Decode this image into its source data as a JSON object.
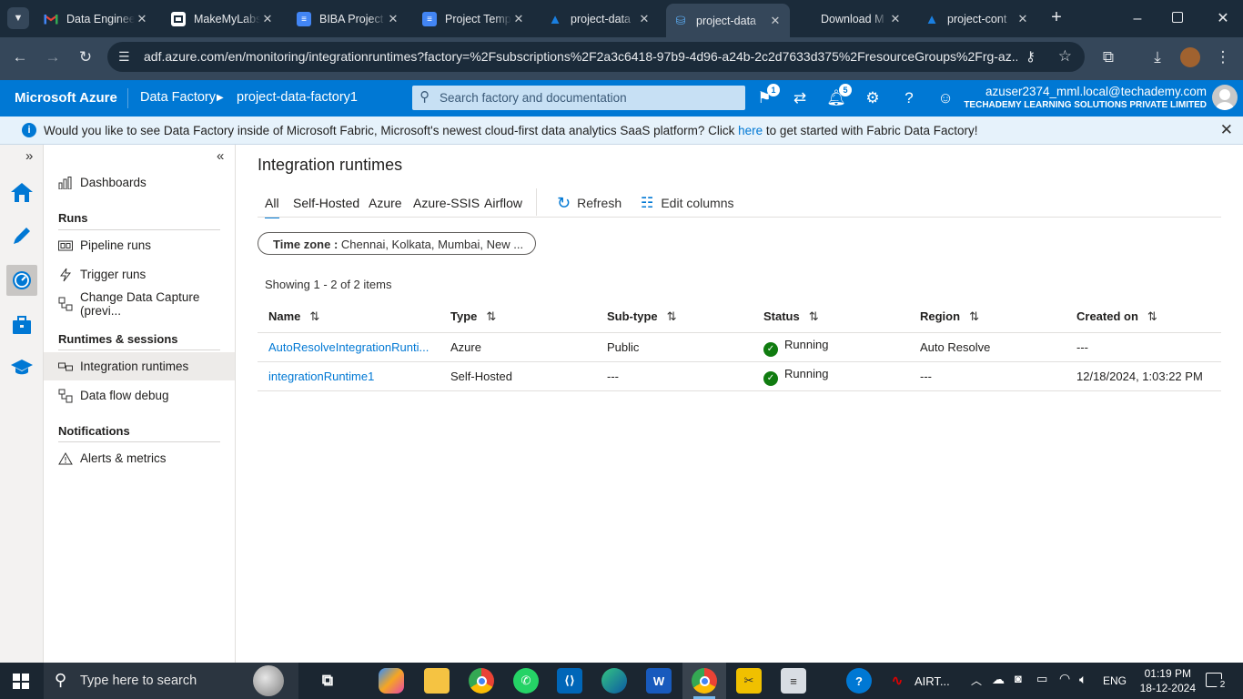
{
  "browser": {
    "tabs": [
      {
        "title": "Data Engineer",
        "favicon": "gmail-icon",
        "color": "#ea4335"
      },
      {
        "title": "MakeMyLabs",
        "favicon": "page-icon",
        "color": "#ffffff"
      },
      {
        "title": "BIBA Project",
        "favicon": "docs-icon",
        "color": "#4285f4"
      },
      {
        "title": "Project Temp",
        "favicon": "docs-icon",
        "color": "#4285f4"
      },
      {
        "title": "project-data",
        "favicon": "azure-icon",
        "color": "#1a7fe0"
      },
      {
        "title": "project-data",
        "favicon": "adf-icon",
        "color": "#59a5e8",
        "active": true
      },
      {
        "title": "Download M",
        "favicon": "microsoft-icon",
        "color": "#f25022"
      },
      {
        "title": "project-cont",
        "favicon": "azure-icon",
        "color": "#1a7fe0"
      }
    ],
    "url": "adf.azure.com/en/monitoring/integrationruntimes?factory=%2Fsubscriptions%2F2a3c6418-97b9-4d96-a24b-2c2d7633d375%2FresourceGroups%2Frg-az..."
  },
  "header": {
    "brand": "Microsoft Azure",
    "crumb_service": "Data Factory",
    "crumb_factory": "project-data-factory1",
    "search_placeholder": "Search factory and documentation",
    "notifications_badge_1": "1",
    "notifications_badge_2": "5",
    "user_email": "azuser2374_mml.local@techademy.com",
    "user_org": "TECHADEMY LEARNING SOLUTIONS PRIVATE LIMITED"
  },
  "banner": {
    "text_before": "Would you like to see Data Factory inside of Microsoft Fabric, Microsoft's newest cloud-first data analytics SaaS platform? Click ",
    "link": "here",
    "text_after": " to get started with Fabric Data Factory!"
  },
  "sidenav": {
    "dashboards": "Dashboards",
    "runs_heading": "Runs",
    "pipeline_runs": "Pipeline runs",
    "trigger_runs": "Trigger runs",
    "change_data_capture": "Change Data Capture (previ...",
    "runtimes_heading": "Runtimes & sessions",
    "integration_runtimes": "Integration runtimes",
    "data_flow_debug": "Data flow debug",
    "notifications_heading": "Notifications",
    "alerts_metrics": "Alerts & metrics"
  },
  "main": {
    "title": "Integration runtimes",
    "filter_tabs": [
      "All",
      "Self-Hosted",
      "Azure",
      "Azure-SSIS",
      "Airflow"
    ],
    "refresh": "Refresh",
    "edit_columns": "Edit columns",
    "timezone_label": "Time zone :",
    "timezone_value": "Chennai, Kolkata, Mumbai, New ...",
    "showing": "Showing 1 - 2 of 2 items",
    "columns": [
      "Name",
      "Type",
      "Sub-type",
      "Status",
      "Region",
      "Created on"
    ],
    "rows": [
      {
        "name": "AutoResolveIntegrationRunti...",
        "type": "Azure",
        "subtype": "Public",
        "status": "Running",
        "region": "Auto Resolve",
        "created": "---"
      },
      {
        "name": "integrationRuntime1",
        "type": "Self-Hosted",
        "subtype": "---",
        "status": "Running",
        "region": "---",
        "created": "12/18/2024, 1:03:22 PM"
      }
    ]
  },
  "taskbar": {
    "search_placeholder": "Type here to search",
    "airtel_label": "AIRT...",
    "language": "ENG",
    "time": "01:19 PM",
    "date": "18-12-2024",
    "notification_count": "2"
  },
  "colors": {
    "azure_blue": "#0078d4",
    "running_green": "#107c10"
  }
}
